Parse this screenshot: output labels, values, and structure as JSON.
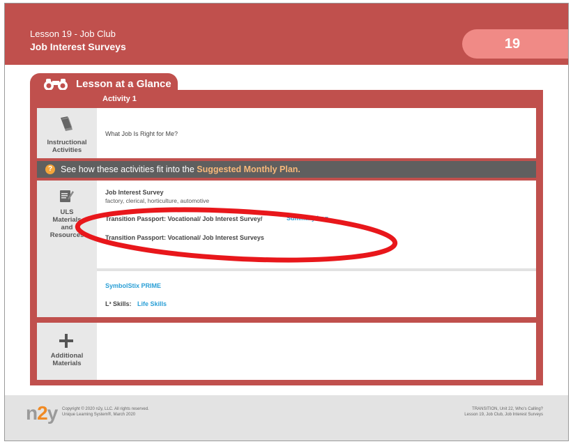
{
  "header": {
    "lesson": "Lesson 19 - Job Club",
    "title": "Job Interest Surveys",
    "badge": "19"
  },
  "glance": {
    "tab_label": "Lesson at a Glance",
    "activity_label": "Activity 1"
  },
  "instructional": {
    "caption_line1": "Instructional",
    "caption_line2": "Activities",
    "text": "What Job Is Right for Me?",
    "icon": "book-icon"
  },
  "banner": {
    "icon": "question-icon",
    "prefix": "See how these activities fit into the",
    "highlight": "Suggested Monthly Plan",
    "suffix": "."
  },
  "uls": {
    "caption_line1": "ULS",
    "caption_line2": "Materials",
    "caption_line3": "and",
    "caption_line4": "Resources",
    "icon": "notepad-icon",
    "survey_title": "Job Interest Survey",
    "survey_sub": "factory, clerical, horticulture, automotive",
    "passport1": "Transition Passport: Vocational/ Job Interest Survey/",
    "passport1_link": "Summary Log",
    "passport2": "Transition Passport: Vocational/ Job Interest Surveys",
    "symbolstix": "SymbolStix PRIME",
    "l3_label": "L³ Skills:",
    "l3_link": "Life Skills"
  },
  "additional": {
    "caption_line1": "Additional",
    "caption_line2": "Materials",
    "icon": "plus-icon"
  },
  "footer": {
    "logo_n": "n",
    "logo_2": "2",
    "logo_y": "y",
    "copyright": "Copyright © 2020 n2y, LLC. All rights reserved.",
    "system": "Unique Learning System®, March 2020",
    "ref_line1": "TRANSITION, Unit 22, Who's Calling?",
    "ref_line2": "Lesson 19, Job Club, Job Interest Surveys"
  },
  "colors": {
    "brand_red": "#c0504d",
    "badge_pink": "#f08a86",
    "link_blue": "#2a9fd6",
    "annotation_red": "#e8171b"
  }
}
